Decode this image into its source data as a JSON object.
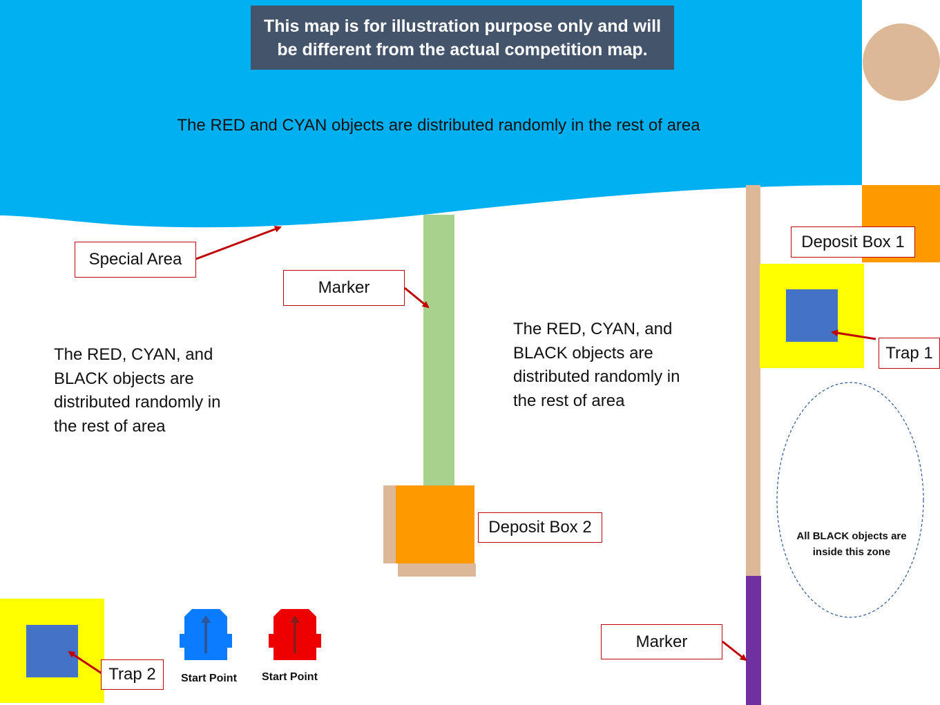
{
  "disclaimer": "This  map is for illustration purpose only and will be different from the actual competition map.",
  "special_area_text": "The RED and CYAN objects are distributed randomly in the rest of area",
  "labels": {
    "special_area": "Special Area",
    "marker_top": "Marker",
    "marker_bottom": "Marker",
    "deposit_box_1": "Deposit Box 1",
    "deposit_box_2": "Deposit Box 2",
    "trap_1": "Trap 1",
    "trap_2": "Trap 2"
  },
  "left_area_text": "The RED, CYAN, and BLACK objects are distributed randomly in the rest of area",
  "right_area_text": "The RED, CYAN, and BLACK objects are distributed randomly in the rest of area",
  "black_zone_text": "All BLACK objects are inside this zone",
  "start_points": {
    "blue_label": "Start Point",
    "red_label": "Start Point"
  },
  "colors": {
    "special_area": "#00b0f0",
    "disclaimer_bg": "#44546a",
    "marker_green": "#a9d18e",
    "wall_tan": "#dcb896",
    "deposit_orange": "#ff9900",
    "trap_yellow": "#ffff00",
    "trap_blue": "#4472c4",
    "marker_purple": "#7030a0",
    "robot_blue": "#0a7cff",
    "robot_red": "#ee0000",
    "arrow_red": "#c00000"
  },
  "icons": {
    "blue_robot": "robot-icon",
    "red_robot": "robot-icon",
    "tan_circle": "circle-icon"
  }
}
